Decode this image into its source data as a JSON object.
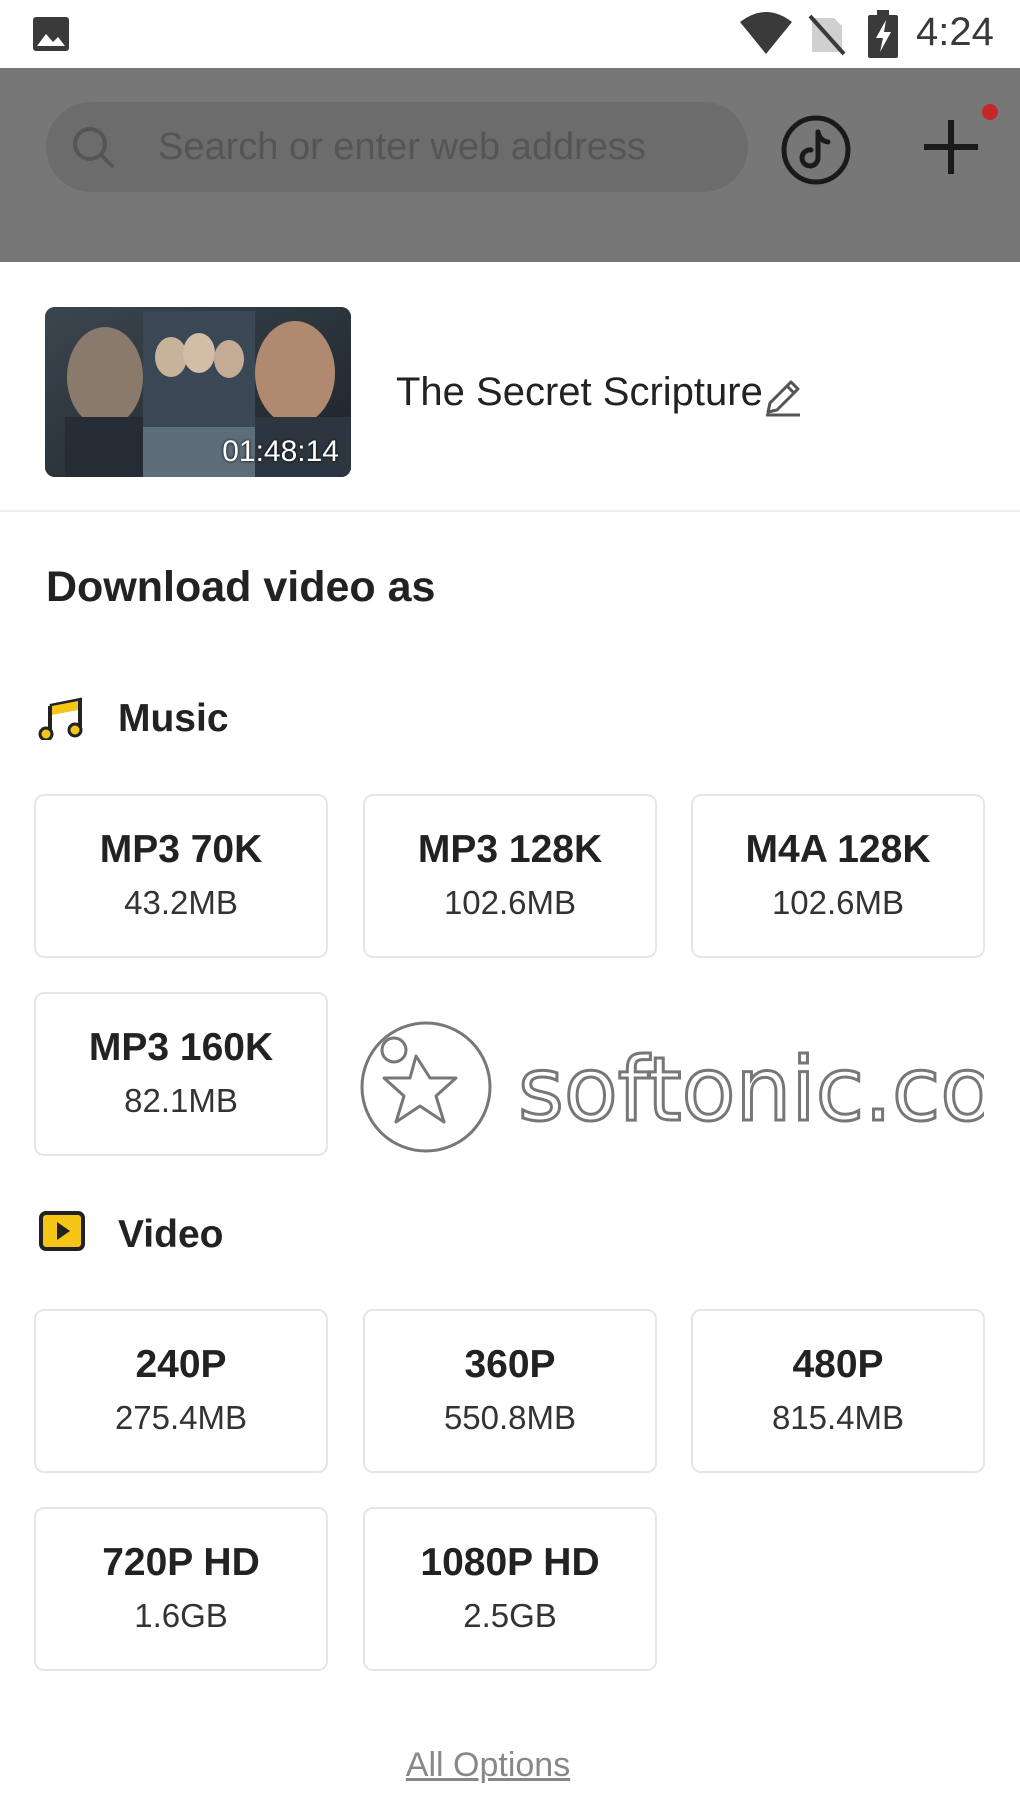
{
  "status_bar": {
    "time": "4:24"
  },
  "search": {
    "placeholder": "Search or enter web address"
  },
  "video": {
    "title": "The Secret Scripture",
    "duration": "01:48:14"
  },
  "download": {
    "heading": "Download video as",
    "music": {
      "label": "Music",
      "options": [
        {
          "quality": "MP3 70K",
          "size": "43.2MB"
        },
        {
          "quality": "MP3 128K",
          "size": "102.6MB"
        },
        {
          "quality": "M4A 128K",
          "size": "102.6MB"
        },
        {
          "quality": "MP3 160K",
          "size": "82.1MB"
        }
      ]
    },
    "video": {
      "label": "Video",
      "options": [
        {
          "quality": "240P",
          "size": "275.4MB"
        },
        {
          "quality": "360P",
          "size": "550.8MB"
        },
        {
          "quality": "480P",
          "size": "815.4MB"
        },
        {
          "quality": "720P HD",
          "size": "1.6GB"
        },
        {
          "quality": "1080P HD",
          "size": "2.5GB"
        }
      ]
    },
    "all_options": "All Options"
  },
  "watermark": "softonic.com",
  "colors": {
    "accent_yellow": "#f5c518",
    "toolbar": "#777777",
    "notification_dot": "#c62828"
  }
}
